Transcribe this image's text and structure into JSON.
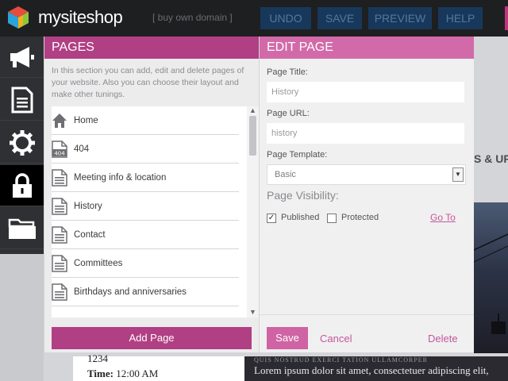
{
  "topbar": {
    "brand": "mysiteshop",
    "domain_link": "[ buy own domain ]",
    "buttons": {
      "undo": "UNDO",
      "save": "SAVE",
      "preview": "PREVIEW",
      "help": "HELP"
    }
  },
  "rail": {
    "items": [
      {
        "icon": "megaphone-icon"
      },
      {
        "icon": "document-icon"
      },
      {
        "icon": "gear-icon"
      },
      {
        "icon": "lock-icon"
      },
      {
        "icon": "folder-icon"
      }
    ],
    "active_index": 3
  },
  "pages_panel": {
    "title": "PAGES",
    "description": "In this section you can add, edit and delete pages of your website. Also you can choose their layout and make other tunings.",
    "pages": [
      {
        "label": "Home",
        "icon": "home-icon"
      },
      {
        "label": "404",
        "icon": "page-404-icon"
      },
      {
        "label": "Meeting info & location",
        "icon": "page-icon"
      },
      {
        "label": "History",
        "icon": "page-icon"
      },
      {
        "label": "Contact",
        "icon": "page-icon"
      },
      {
        "label": "Committees",
        "icon": "page-icon"
      },
      {
        "label": "Birthdays and anniversaries",
        "icon": "page-icon"
      }
    ],
    "add_button": "Add Page"
  },
  "edit_panel": {
    "title": "EDIT PAGE",
    "page_title_label": "Page Title:",
    "page_title_value": "History",
    "page_url_label": "Page URL:",
    "page_url_value": "history",
    "template_label": "Page Template:",
    "template_value": "Basic",
    "visibility_title": "Page Visibility:",
    "published_label": "Published",
    "published_checked": true,
    "protected_label": "Protected",
    "protected_checked": false,
    "goto_link": "Go To",
    "save_button": "Save",
    "cancel_link": "Cancel",
    "delete_link": "Delete"
  },
  "background_site": {
    "heading": "S & UPD",
    "caption": "QUIS NOSTRUD EXERCI TATION ULLAMCORPER",
    "lorem": "Lorem ipsum dolor sit amet, consectetuer adipiscing elit,",
    "number": "1234",
    "time_label": "Time:",
    "time_value": "12:00 AM"
  },
  "colors": {
    "accent": "#b13f84",
    "accent_light": "#d26aa9",
    "topbar": "#1e1f21",
    "toolbar_button": "#18385b"
  }
}
